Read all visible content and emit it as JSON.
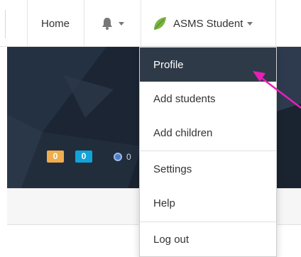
{
  "navbar": {
    "home_label": "Home",
    "bell_icon": "bell-icon",
    "user_icon": "leaf-icon",
    "user_name": "ASMS Student"
  },
  "hero": {
    "badge_orange": "0",
    "badge_blue": "0",
    "bitcount": "0"
  },
  "menu": {
    "items": [
      {
        "label": "Profile",
        "active": true
      },
      {
        "label": "Add students"
      },
      {
        "label": "Add children"
      },
      {
        "label": "Settings"
      },
      {
        "label": "Help"
      },
      {
        "label": "Log out"
      }
    ]
  },
  "colors": {
    "menu_active_bg": "#2f3a48",
    "hero_bg": "#1e2a38",
    "badge_orange": "#f0ad4e",
    "badge_blue": "#12a3d8",
    "leaf_green": "#7cb342",
    "pointer_arrow": "#e91eb8"
  }
}
